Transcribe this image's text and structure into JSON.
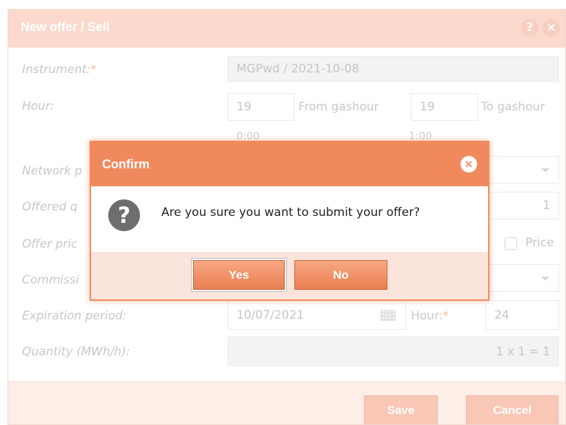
{
  "window": {
    "title": "New offer / Sell",
    "help_glyph": "?",
    "close_glyph": "×"
  },
  "form": {
    "instrument": {
      "label": "Instrument:",
      "required": "*",
      "value": "MGPwd / 2021-10-08"
    },
    "hour": {
      "label": "Hour:",
      "from_value": "19",
      "from_label": "From gashour",
      "from_time": "0:00",
      "to_value": "19",
      "to_label": "To gashour",
      "to_time": "1:00"
    },
    "network": {
      "label": "Network p"
    },
    "offered_qty": {
      "label": "Offered q",
      "value": "1"
    },
    "offer_price": {
      "label": "Offer pric",
      "checkbox_label": "Price"
    },
    "commission": {
      "label": "Commissi"
    },
    "expiration": {
      "label": "Expiration period:",
      "date": "10/07/2021",
      "hour_label": "Hour:",
      "hour_required": "*",
      "hour_value": "24"
    },
    "quantity": {
      "label": "Quantity (MWh/h):",
      "value": "1 x 1 = 1"
    }
  },
  "footer": {
    "save_label": "Save",
    "cancel_label": "Cancel"
  },
  "dialog": {
    "title": "Confirm",
    "close_glyph": "×",
    "icon_glyph": "?",
    "message": "Are you sure you want to submit your offer?",
    "yes_label": "Yes",
    "no_label": "No"
  },
  "colors": {
    "accent": "#f08a5d",
    "title_bar_faded": "#fbd9cc"
  }
}
